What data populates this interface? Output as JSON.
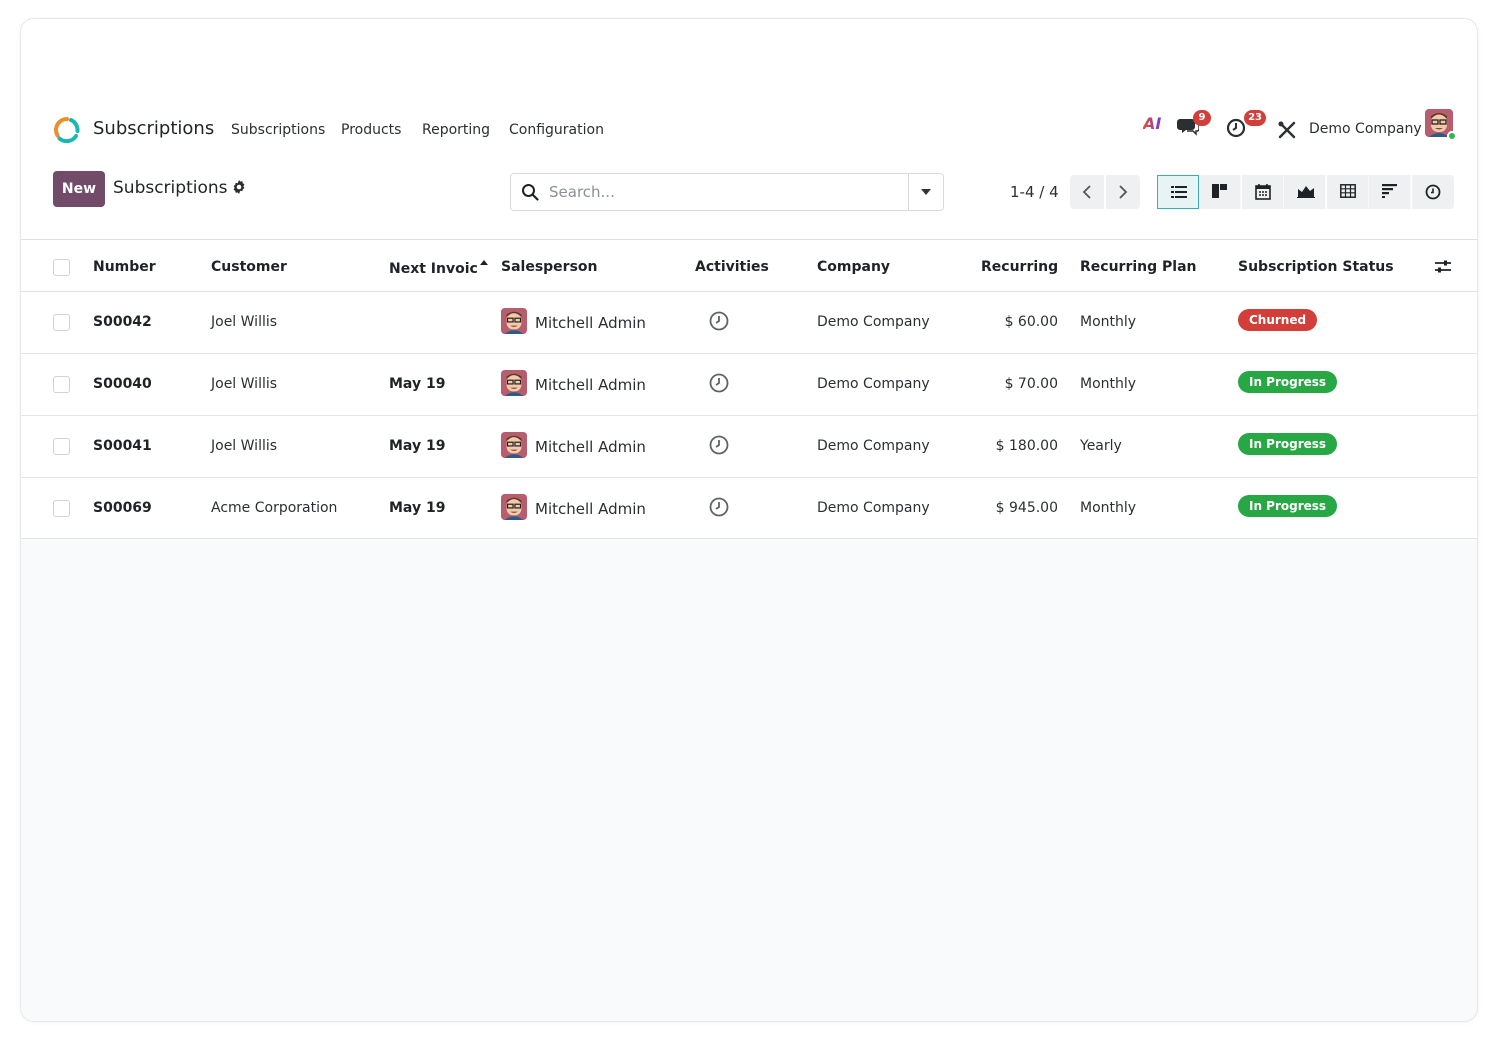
{
  "navbar": {
    "app_name": "Subscriptions",
    "menu": [
      "Subscriptions",
      "Products",
      "Reporting",
      "Configuration"
    ],
    "ai_label": "AI",
    "messages_count": "9",
    "activities_count": "23",
    "company": "Demo Company"
  },
  "control_panel": {
    "new_label": "New",
    "title": "Subscriptions",
    "search_placeholder": "Search...",
    "pager": "1-4 / 4"
  },
  "views": [
    "list-view",
    "kanban-view",
    "calendar-view",
    "graph-view",
    "pivot-view",
    "cohort-view",
    "activity-view"
  ],
  "table": {
    "headers": {
      "number": "Number",
      "customer": "Customer",
      "next_invoice": "Next Invoic",
      "salesperson": "Salesperson",
      "activities": "Activities",
      "company": "Company",
      "recurring": "Recurring",
      "recurring_plan": "Recurring Plan",
      "status": "Subscription Status"
    },
    "rows": [
      {
        "number": "S00042",
        "customer": "Joel Willis",
        "next_invoice": "",
        "salesperson": "Mitchell Admin",
        "company": "Demo Company",
        "recurring": "$ 60.00",
        "plan": "Monthly",
        "status": "Churned",
        "status_color": "#d23f3a"
      },
      {
        "number": "S00040",
        "customer": "Joel Willis",
        "next_invoice": "May 19",
        "salesperson": "Mitchell Admin",
        "company": "Demo Company",
        "recurring": "$ 70.00",
        "plan": "Monthly",
        "status": "In Progress",
        "status_color": "#28a745"
      },
      {
        "number": "S00041",
        "customer": "Joel Willis",
        "next_invoice": "May 19",
        "salesperson": "Mitchell Admin",
        "company": "Demo Company",
        "recurring": "$ 180.00",
        "plan": "Yearly",
        "status": "In Progress",
        "status_color": "#28a745"
      },
      {
        "number": "S00069",
        "customer": "Acme Corporation",
        "next_invoice": "May 19",
        "salesperson": "Mitchell Admin",
        "company": "Demo Company",
        "recurring": "$ 945.00",
        "plan": "Monthly",
        "status": "In Progress",
        "status_color": "#28a745"
      }
    ]
  },
  "colors": {
    "brand": "#714b67",
    "accent": "#3dabb5",
    "churned": "#d23f3a",
    "in_progress": "#28a745"
  }
}
